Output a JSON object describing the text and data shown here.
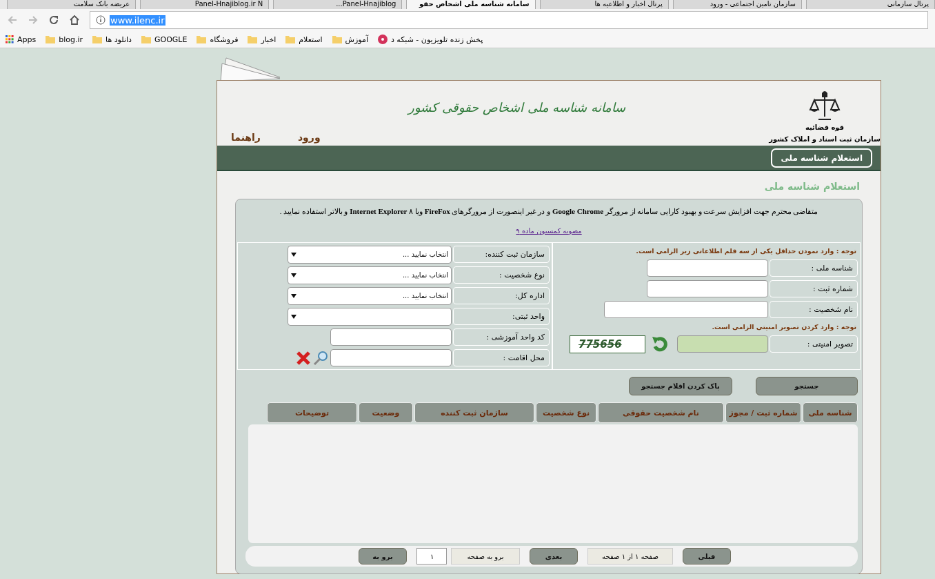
{
  "browser": {
    "tabs": [
      {
        "title": "پرتال سازمانی",
        "selected": false
      },
      {
        "title": "سازمان تامین اجتماعی - ورود",
        "selected": false
      },
      {
        "title": "پرتال اخبار و اطلاعیه ها",
        "selected": false
      },
      {
        "title": "سامانه شناسه ملی اشخاص حقو",
        "selected": true
      },
      {
        "title": "Panel-Hnajiblog...",
        "selected": false
      },
      {
        "title": "Panel-Hnajiblog.ir N",
        "selected": false
      },
      {
        "title": "عریضه بانک سلامت",
        "selected": false
      }
    ],
    "url": "www.ilenc.ir",
    "bookmarks": [
      {
        "label": "پخش زنده تلویزیون - شبکه د",
        "kind": "site"
      },
      {
        "label": "آموزش",
        "kind": "folder"
      },
      {
        "label": "استعلام",
        "kind": "folder"
      },
      {
        "label": "اخبار",
        "kind": "folder"
      },
      {
        "label": "فروشگاه",
        "kind": "folder"
      },
      {
        "label": "GOOGLE",
        "kind": "folder"
      },
      {
        "label": "دانلود ها",
        "kind": "folder"
      },
      {
        "label": "blog.ir",
        "kind": "folder"
      },
      {
        "label": "Apps",
        "kind": "apps"
      }
    ]
  },
  "header": {
    "emblem_caption": "قوه قضائیه",
    "organization": "سازمان ثبت اسناد و املاک کشور",
    "site_title": "سامانه شناسه ملی اشخاص حقوقی کشور",
    "nav": [
      "ورود",
      "راهنما"
    ]
  },
  "menu": [
    {
      "label": "استعلام شناسه ملی",
      "selected": true
    }
  ],
  "page_title": "استعلام شناسه ملی",
  "notice": "متقاضی محترم جهت افزایش سرعت و بهبود کارایی سامانه از مرورگر **Google Chrome** و در غیر اینصورت از مرورگرهای **FireFox** ویا ۸ **Internet Explorer** و بالاتر استفاده نمایید .",
  "notice_link": "مصوبه کمسیون ماده ۹",
  "right_form": {
    "note": "توجه : وارد نمودن حداقل یکی از سه قلم اطلاعاتی زیر الزامی است.",
    "fields": [
      {
        "label": "شناسه ملی :",
        "kind": "short"
      },
      {
        "label": "شماره ثبت :",
        "kind": "short"
      },
      {
        "label": "نام شخصیت :",
        "kind": "long"
      }
    ],
    "captcha_note": "توجه : وارد کردن تصویر امنیتی الزامی است.",
    "captcha_label": "تصویر امنیتی :",
    "captcha_code": "775656"
  },
  "left_form": {
    "fields": [
      {
        "label": "سازمان ثبت کننده:",
        "kind": "select",
        "value": "انتخاب نمایید ..."
      },
      {
        "label": "نوع شخصیت :",
        "kind": "select",
        "value": "انتخاب نمایید ..."
      },
      {
        "label": "اداره کل:",
        "kind": "select",
        "value": "انتخاب نمایید ..."
      },
      {
        "label": "واحد ثبتی:",
        "kind": "select"
      },
      {
        "label": "کد واحد آموزشی :",
        "kind": "input"
      },
      {
        "label": "محل اقامت :",
        "kind": "lookup"
      }
    ]
  },
  "buttons": [
    "جستجو",
    "پاک کردن اقلام جستجو"
  ],
  "table": {
    "columns": [
      "شناسه ملی",
      "شماره ثبت / مجوز",
      "نام شخصیت حقوقی",
      "نوع شخصیت",
      "سازمان ثبت کننده",
      "وضعیت",
      "توضیحات"
    ]
  },
  "pager": {
    "previous": "قبلی",
    "page_info": "صفحه ۱ از ۱ صفحه",
    "next": "بعدی",
    "goto_label": "برو به صفحه",
    "page_value": "۱",
    "go": "برو به"
  }
}
